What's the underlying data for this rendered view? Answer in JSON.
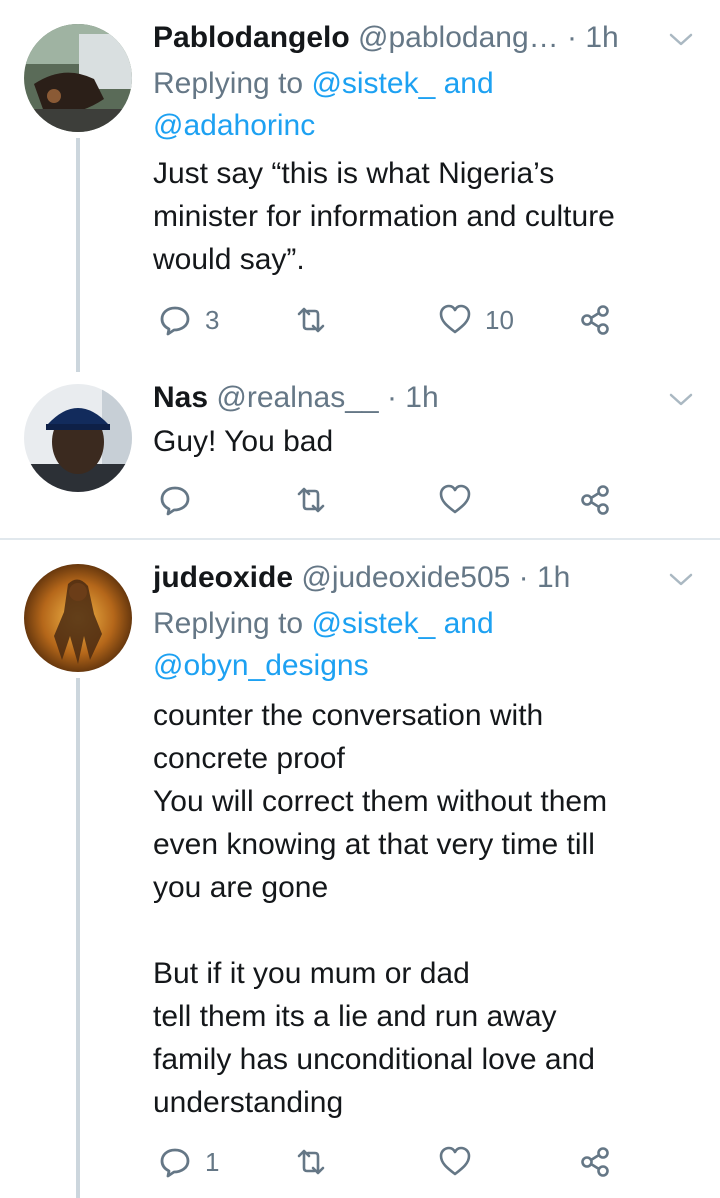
{
  "tweets": [
    {
      "name": "Pablodangelo",
      "handle": "@pablodang…",
      "dot": " · ",
      "time": "1h",
      "reply_prefix": "Replying to ",
      "reply_user1": "@sistek_",
      "reply_and": " and",
      "reply_user2": "@adahorinc",
      "text": "Just say “this is what Nigeria’s\nminister for information and culture\nwould say”.",
      "replies": "3",
      "retweets": "",
      "likes": "10"
    },
    {
      "name": "Nas",
      "handle": "@realnas__",
      "dot": " · ",
      "time": "1h",
      "text": "Guy! You bad",
      "replies": "",
      "retweets": "",
      "likes": ""
    },
    {
      "name": "judeoxide",
      "handle": "@judeoxide505",
      "dot": " · ",
      "time": "1h",
      "reply_prefix": "Replying to ",
      "reply_user1": "@sistek_",
      "reply_and": " and",
      "reply_user2": "@obyn_designs",
      "text": "counter the conversation with\nconcrete proof\nYou will correct them without them\neven knowing at that very time till\nyou are gone\n\nBut if it you mum or dad\ntell them its a lie and run away\nfamily has unconditional love and\nunderstanding",
      "replies": "1",
      "retweets": "",
      "likes": ""
    }
  ],
  "icons": {
    "reply": "reply-icon",
    "retweet": "retweet-icon",
    "like": "heart-icon",
    "share": "share-icon",
    "menu": "chevron-down-icon"
  },
  "colors": {
    "link": "#1da1f2",
    "secondary": "#657786",
    "thread_line": "#ccd6dd",
    "divider": "#e1e8ed"
  }
}
